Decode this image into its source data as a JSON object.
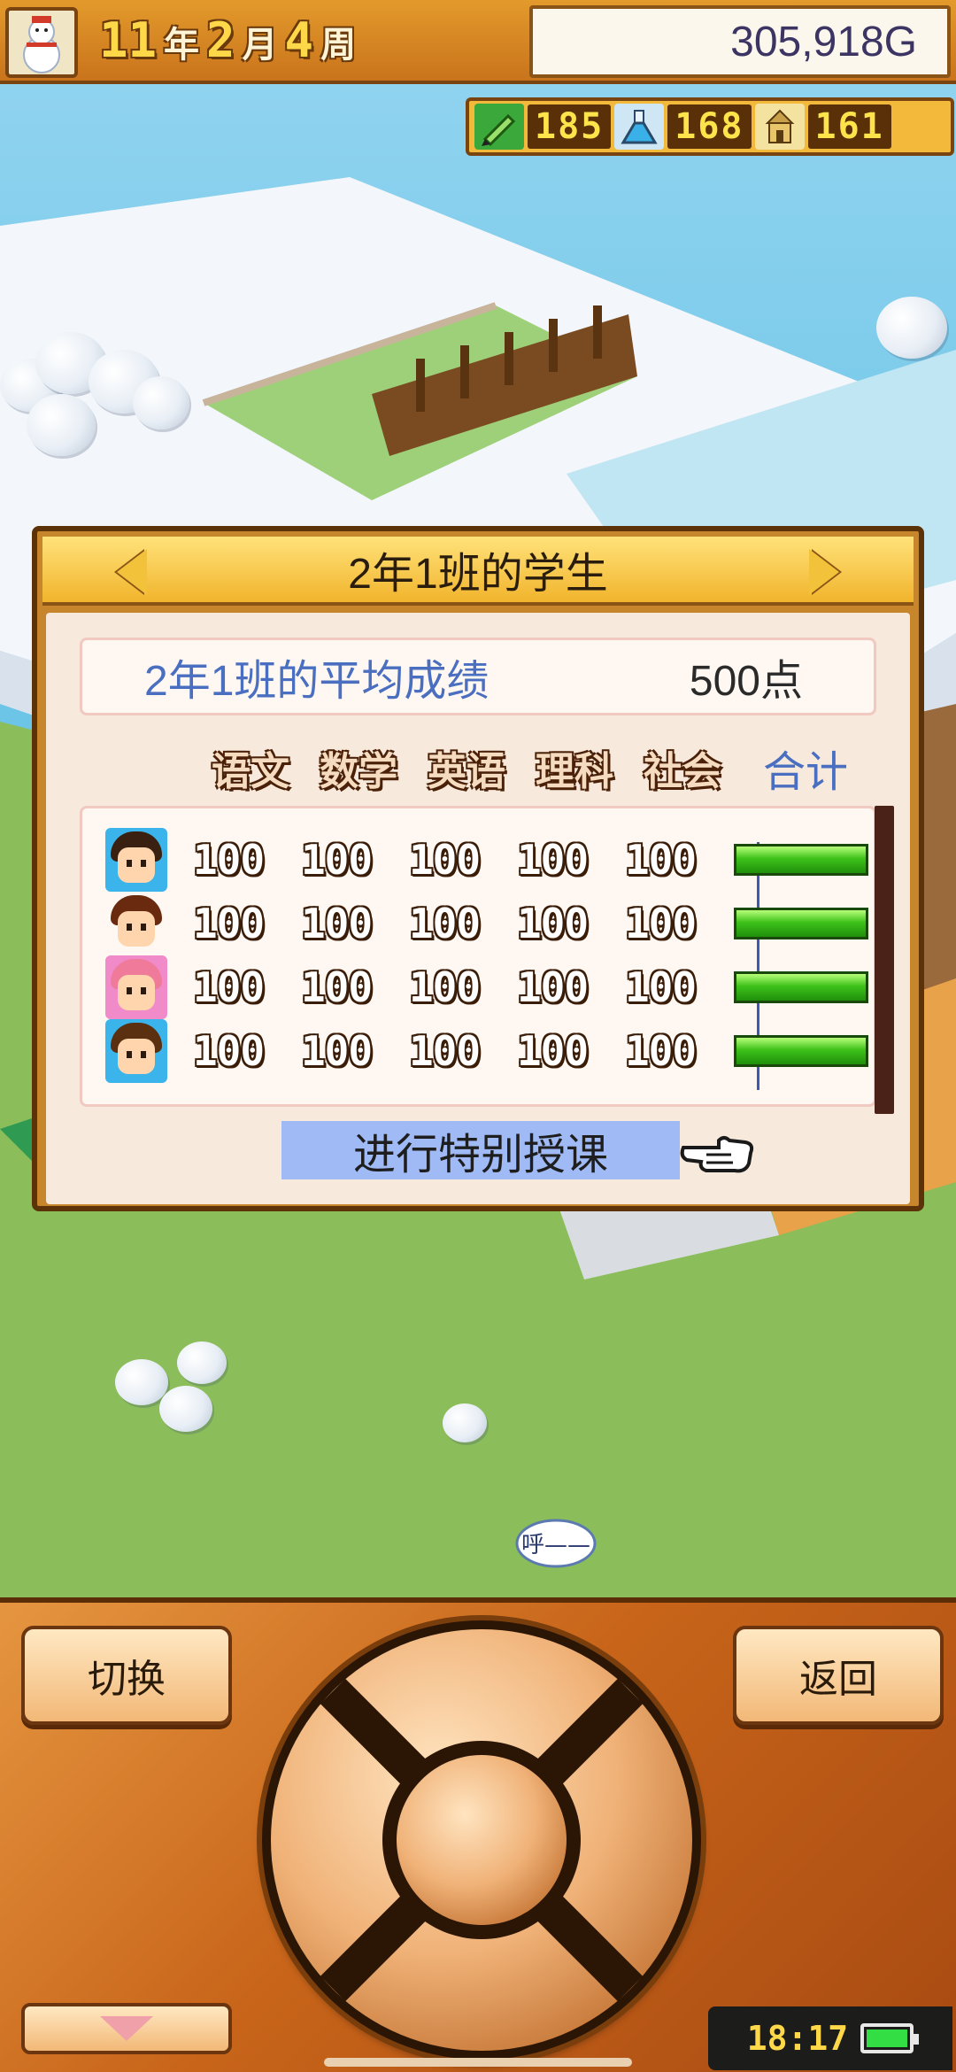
{
  "hud": {
    "date": {
      "year": "11",
      "year_unit": "年",
      "month": "2",
      "month_unit": "月",
      "week": "4",
      "week_unit": "周"
    },
    "money": "305,918G",
    "resources": [
      {
        "icon": "pencil-icon",
        "value": "185"
      },
      {
        "icon": "flask-icon",
        "value": "168"
      },
      {
        "icon": "building-icon",
        "value": "161"
      }
    ]
  },
  "dialog": {
    "title": "2年1班的学生",
    "average_label": "2年1班的平均成绩",
    "average_value": "500点",
    "subjects": [
      "语文",
      "数学",
      "英语",
      "理科",
      "社会"
    ],
    "total_label": "合计",
    "students": [
      {
        "avatar": "boy-student-icon",
        "scores": [
          "100",
          "100",
          "100",
          "100",
          "100"
        ],
        "total_fraction": 1.0
      },
      {
        "avatar": "girl-student-icon",
        "scores": [
          "100",
          "100",
          "100",
          "100",
          "100"
        ],
        "total_fraction": 1.0
      },
      {
        "avatar": "pink-hair-student-icon",
        "scores": [
          "100",
          "100",
          "100",
          "100",
          "100"
        ],
        "total_fraction": 1.0
      },
      {
        "avatar": "boy-student-icon",
        "scores": [
          "100",
          "100",
          "100",
          "100",
          "100"
        ],
        "total_fraction": 1.0
      }
    ],
    "special_lesson_label": "进行特别授课"
  },
  "scene": {
    "speech_bubble": "呼——"
  },
  "controller": {
    "switch_label": "切换",
    "back_label": "返回",
    "clock": "18:17",
    "battery_level": 1.0
  },
  "colors": {
    "accent_blue": "#4a6fc0",
    "bar_green": "#3ec21a",
    "hud_orange": "#e39a2b",
    "button_highlight": "#9fbaf5"
  }
}
